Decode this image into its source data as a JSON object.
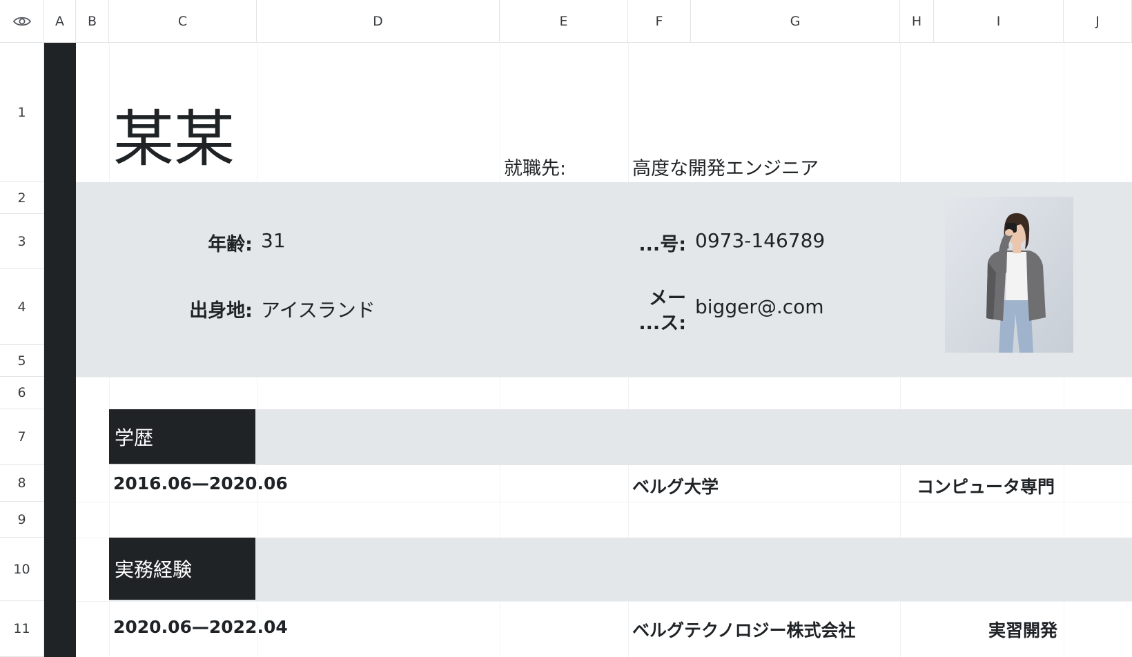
{
  "header": {
    "columns": [
      "A",
      "B",
      "C",
      "D",
      "E",
      "F",
      "G",
      "H",
      "I",
      "J"
    ],
    "rows": [
      "1",
      "2",
      "3",
      "4",
      "5",
      "6",
      "7",
      "8",
      "9",
      "10",
      "11"
    ]
  },
  "profile": {
    "name": "某某",
    "job_label": "就職先:",
    "job_value": "高度な開発エンジニア",
    "age_label": "年齢:",
    "age_value": "31",
    "birthplace_label": "出身地:",
    "birthplace_value": "アイスランド",
    "phone_label": "...号:",
    "phone_value": "0973-146789",
    "mail_label_1": "メー",
    "mail_label_2": "...ス:",
    "mail_value": "bigger@.com"
  },
  "education": {
    "title": "学歴",
    "period": "2016.06—2020.06",
    "school": "ベルグ大学",
    "major": "コンピュータ専門"
  },
  "experience": {
    "title": "実務経験",
    "period": "2020.06—2022.04",
    "company": "ベルグテクノロジー株式会社",
    "role": "実習開発"
  },
  "colors": {
    "dark": "#202326",
    "band": "#e4e7ea",
    "grid": "#e2e4e6"
  },
  "icons": {
    "corner": "eye-icon"
  }
}
